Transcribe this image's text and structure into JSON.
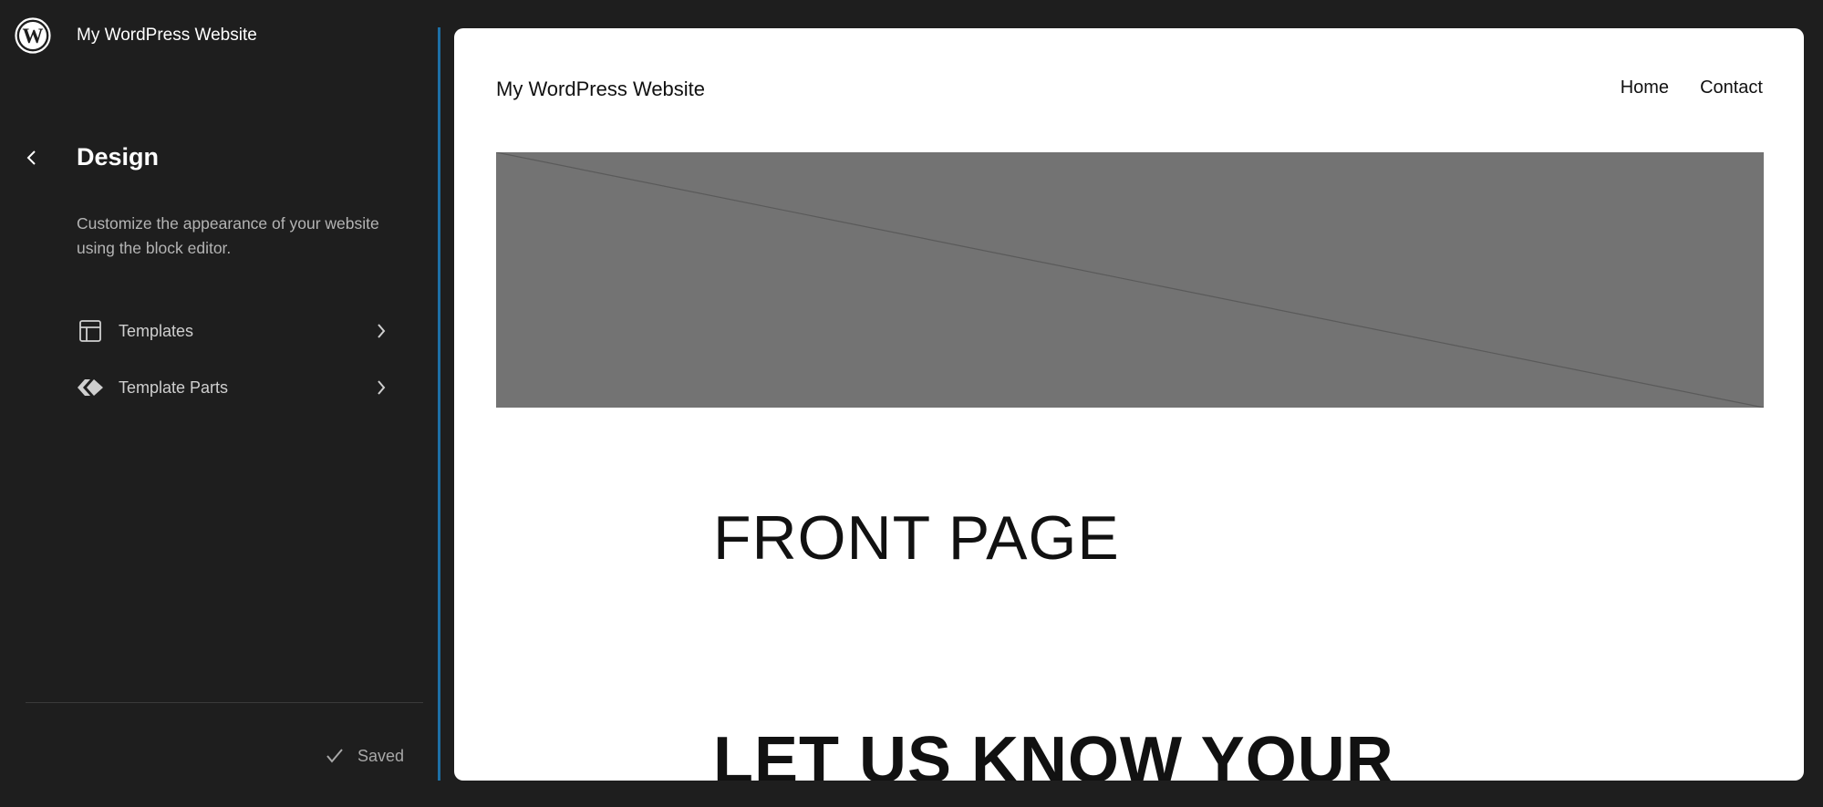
{
  "sidebar": {
    "site_name": "My WordPress Website",
    "logo_icon": "wordpress-logo-icon",
    "back_icon": "chevron-left-icon",
    "section_title": "Design",
    "section_description": "Customize the appearance of your website using the block editor.",
    "items": [
      {
        "label": "Templates",
        "icon": "layout-icon",
        "chevron": "chevron-right-icon"
      },
      {
        "label": "Template Parts",
        "icon": "symbol-filled-icon",
        "chevron": "chevron-right-icon"
      }
    ],
    "status": {
      "label": "Saved",
      "icon": "check-icon"
    }
  },
  "preview": {
    "site_title": "My WordPress Website",
    "nav": [
      "Home",
      "Contact"
    ],
    "heading": "FRONT PAGE",
    "heading2": "LET US KNOW YOUR"
  },
  "colors": {
    "sidebar_bg": "#1e1e1e",
    "accent": "#1d6fa5",
    "cover": "#737373",
    "canvas": "#ffffff"
  }
}
